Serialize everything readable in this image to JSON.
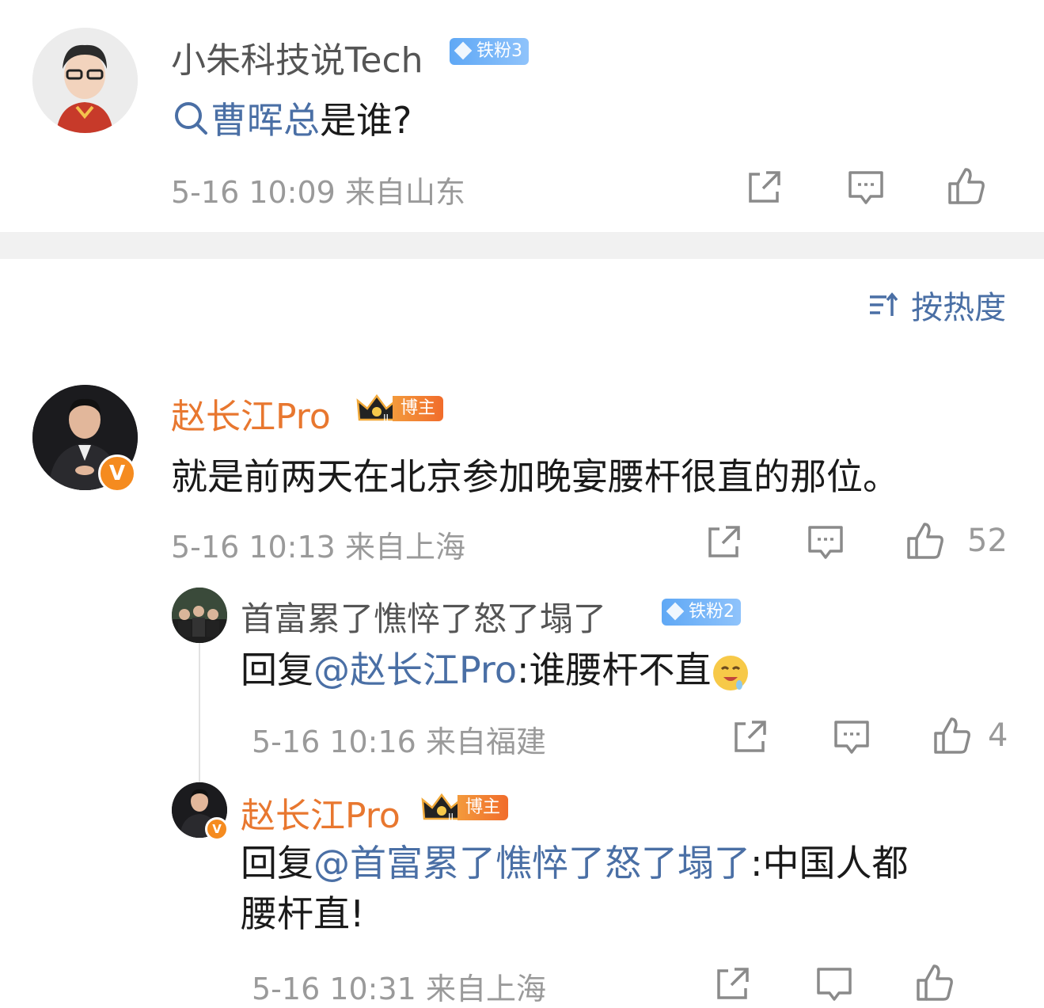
{
  "post": {
    "author": "小朱科技说Tech",
    "fan_badge": "铁粉3",
    "search_keyword": "曹晖总",
    "text_suffix": "是谁?",
    "time": "5-16 10:09",
    "location": "来自山东"
  },
  "sort": {
    "label": "按热度"
  },
  "comments": [
    {
      "author": "赵长江Pro",
      "badge": "博主",
      "text": "就是前两天在北京参加晚宴腰杆很直的那位。",
      "time": "5-16 10:13",
      "location": "来自上海",
      "likes": "52"
    }
  ],
  "replies": [
    {
      "author": "首富累了憔悴了怒了塌了",
      "fan_badge": "铁粉2",
      "reply_prefix": "回复",
      "mention": "@赵长江Pro",
      "text": ":谁腰杆不直",
      "emoji": "drooling-face-emoji",
      "time": "5-16 10:16",
      "location": "来自福建",
      "likes": "4"
    },
    {
      "author": "赵长江Pro",
      "badge": "博主",
      "reply_prefix": "回复",
      "mention": "@首富累了憔悴了怒了塌了",
      "text": ":中国人都",
      "text_line2": "腰杆直!",
      "time": "5-16 10:31",
      "location": "来自上海"
    }
  ],
  "colors": {
    "link": "#4a6fa5",
    "blogger_name": "#e8772f",
    "meta": "#9a9a9a",
    "fan_badge": "#5fa8f5"
  }
}
